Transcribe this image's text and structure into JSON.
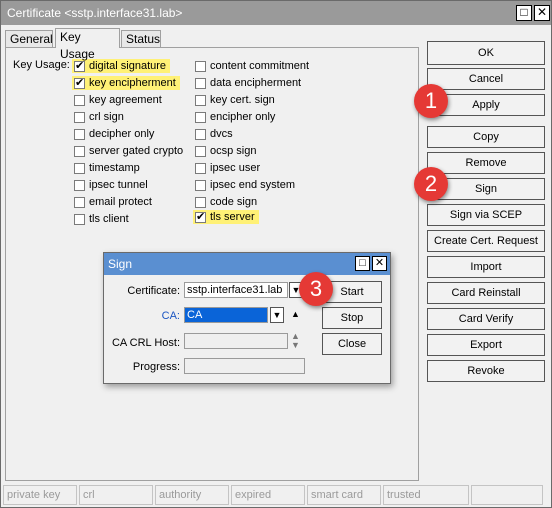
{
  "window": {
    "title": "Certificate <sstp.interface31.lab>"
  },
  "tabs": [
    {
      "label": "General",
      "active": false
    },
    {
      "label": "Key Usage",
      "active": true
    },
    {
      "label": "Status",
      "active": false
    }
  ],
  "key_usage": {
    "label": "Key Usage:",
    "left_column": [
      {
        "label": "digital signature",
        "checked": true,
        "highlighted": true
      },
      {
        "label": "key encipherment",
        "checked": true,
        "highlighted": true
      },
      {
        "label": "key agreement",
        "checked": false
      },
      {
        "label": "crl sign",
        "checked": false
      },
      {
        "label": "decipher only",
        "checked": false
      },
      {
        "label": "server gated crypto",
        "checked": false
      },
      {
        "label": "timestamp",
        "checked": false
      },
      {
        "label": "ipsec tunnel",
        "checked": false
      },
      {
        "label": "email protect",
        "checked": false
      },
      {
        "label": "tls client",
        "checked": false
      }
    ],
    "right_column": [
      {
        "label": "content commitment",
        "checked": false
      },
      {
        "label": "data encipherment",
        "checked": false
      },
      {
        "label": "key cert. sign",
        "checked": false
      },
      {
        "label": "encipher only",
        "checked": false
      },
      {
        "label": "dvcs",
        "checked": false
      },
      {
        "label": "ocsp sign",
        "checked": false
      },
      {
        "label": "ipsec user",
        "checked": false
      },
      {
        "label": "ipsec end system",
        "checked": false
      },
      {
        "label": "code sign",
        "checked": false
      },
      {
        "label": "tls server",
        "checked": true,
        "highlighted": true
      }
    ]
  },
  "buttons": {
    "ok": "OK",
    "cancel": "Cancel",
    "apply": "Apply",
    "copy": "Copy",
    "remove": "Remove",
    "sign": "Sign",
    "sign_via_scep": "Sign via SCEP",
    "create_cert_request": "Create Cert. Request",
    "import": "Import",
    "card_reinstall": "Card Reinstall",
    "card_verify": "Card Verify",
    "export": "Export",
    "revoke": "Revoke"
  },
  "status_bar": [
    "private key",
    "crl",
    "authority",
    "expired",
    "smart card key",
    "trusted",
    ""
  ],
  "markers": {
    "one": "1",
    "two": "2",
    "three": "3"
  },
  "sign_dialog": {
    "title": "Sign",
    "certificate_label": "Certificate:",
    "certificate_value": "sstp.interface31.lab",
    "ca_label": "CA:",
    "ca_value": "CA",
    "crl_host_label": "CA CRL Host:",
    "crl_host_value": "",
    "progress_label": "Progress:",
    "progress_value": "",
    "start": "Start",
    "stop": "Stop",
    "close": "Close"
  },
  "colors": {
    "highlight": "#fff176",
    "marker": "#e53935",
    "dialog_titlebar": "#5a8fd1",
    "ca_selection": "#0a64d8"
  }
}
